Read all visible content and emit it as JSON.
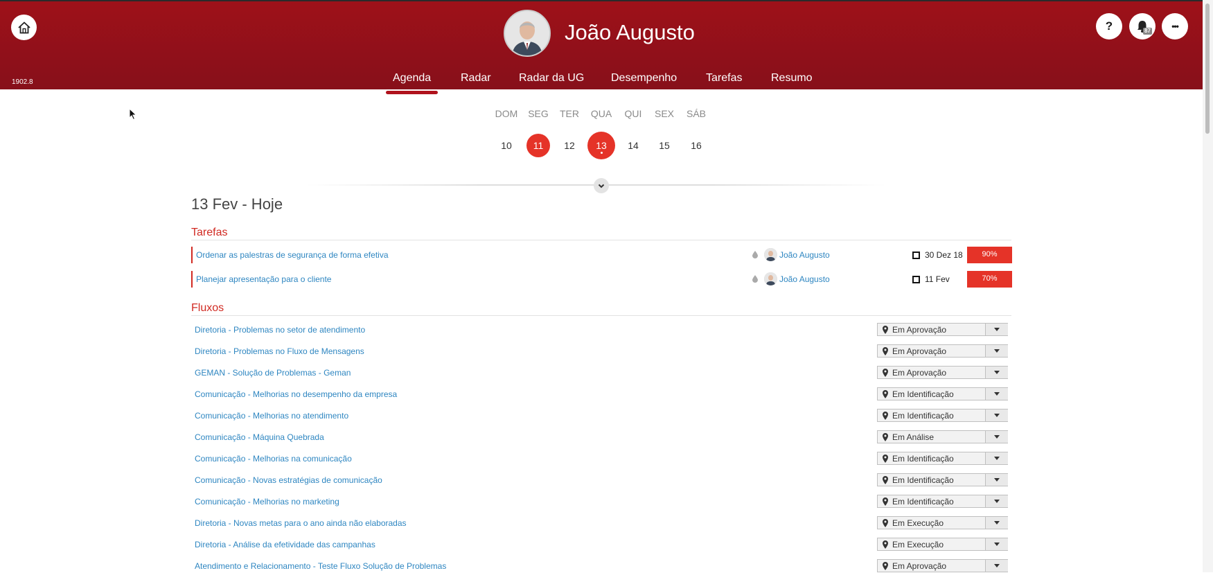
{
  "header": {
    "version": "1902.8",
    "user_name": "João Augusto",
    "help_label": "?",
    "notifications_count": "87",
    "more_label": "•••",
    "colors": {
      "brand": "#9e1119",
      "accent": "#e53328",
      "link": "#2e86c1"
    }
  },
  "tabs": [
    {
      "label": "Agenda",
      "active": true
    },
    {
      "label": "Radar"
    },
    {
      "label": "Radar da UG"
    },
    {
      "label": "Desempenho"
    },
    {
      "label": "Tarefas"
    },
    {
      "label": "Resumo"
    }
  ],
  "calendar": {
    "days": [
      {
        "name": "DOM",
        "num": "10"
      },
      {
        "name": "SEG",
        "num": "11",
        "selected": true
      },
      {
        "name": "TER",
        "num": "12"
      },
      {
        "name": "QUA",
        "num": "13",
        "today": true
      },
      {
        "name": "QUI",
        "num": "14"
      },
      {
        "name": "SEX",
        "num": "15"
      },
      {
        "name": "SÁB",
        "num": "16"
      }
    ]
  },
  "agenda": {
    "date_heading": "13 Fev - Hoje",
    "tasks_title": "Tarefas",
    "tasks": [
      {
        "title": "Ordenar as palestras de segurança de forma efetiva",
        "user": "João Augusto",
        "date": "30 Dez 18",
        "progress": "90%"
      },
      {
        "title": "Planejar apresentação para o cliente",
        "user": "João Augusto",
        "date": "11 Fev",
        "progress": "70%"
      }
    ],
    "flows_title": "Fluxos",
    "flows": [
      {
        "title": "Diretoria - Problemas no setor de atendimento",
        "status": "Em Aprovação"
      },
      {
        "title": "Diretoria - Problemas no Fluxo de Mensagens",
        "status": "Em Aprovação"
      },
      {
        "title": "GEMAN - Solução de Problemas - Geman",
        "status": "Em Aprovação"
      },
      {
        "title": "Comunicação - Melhorias no desempenho da empresa",
        "status": "Em Identificação"
      },
      {
        "title": "Comunicação - Melhorias no atendimento",
        "status": "Em Identificação"
      },
      {
        "title": "Comunicação - Máquina Quebrada",
        "status": "Em Análise"
      },
      {
        "title": "Comunicação - Melhorias na comunicação",
        "status": "Em Identificação"
      },
      {
        "title": "Comunicação - Novas estratégias de comunicação",
        "status": "Em Identificação"
      },
      {
        "title": "Comunicação - Melhorias no marketing",
        "status": "Em Identificação"
      },
      {
        "title": "Diretoria - Novas metas para o ano ainda não elaboradas",
        "status": "Em Execução"
      },
      {
        "title": "Diretoria - Análise da efetividade das campanhas",
        "status": "Em Execução"
      },
      {
        "title": "Atendimento e Relacionamento - Teste Fluxo Solução de Problemas",
        "status": "Em Aprovação"
      }
    ]
  }
}
